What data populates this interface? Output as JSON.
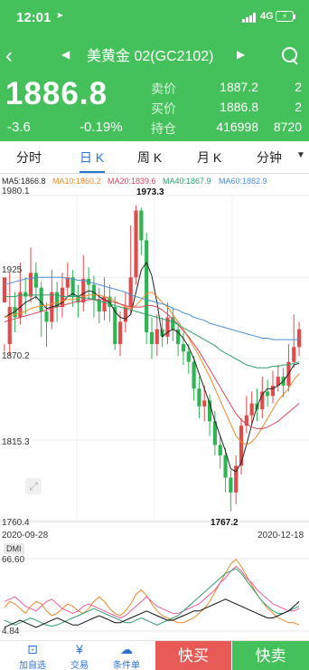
{
  "status": {
    "time": "12:01",
    "network": "4G",
    "battery_icon": "battery-charging-icon"
  },
  "nav": {
    "title": "美黄金 02(GC2102)"
  },
  "quote": {
    "price": "1886.8",
    "change": "-3.6",
    "change_pct": "-0.19%",
    "ask_label": "卖价",
    "ask": "1887.2",
    "ask_qty": "2",
    "bid_label": "买价",
    "bid": "1886.8",
    "bid_qty": "2",
    "oi_label": "持仓",
    "oi": "416998",
    "oi_qty": "8720"
  },
  "tabs": [
    "分时",
    "日 K",
    "周 K",
    "月 K",
    "分钟"
  ],
  "active_tab": "日 K",
  "ma_legend": [
    {
      "text": "MA5:1866.8",
      "color": "#222222"
    },
    {
      "text": "MA10:1860.2",
      "color": "#f08a2a"
    },
    {
      "text": "MA20:1839.6",
      "color": "#d6455b"
    },
    {
      "text": "MA40:1867.9",
      "color": "#2e9e6a"
    },
    {
      "text": "MA60:1882.9",
      "color": "#4a8ed8"
    }
  ],
  "chart_data": {
    "type": "candlestick",
    "y_labels": [
      "1980.1",
      "1925",
      "1870.2",
      "1815.3",
      "1760.4"
    ],
    "high_marker": "1973.3",
    "low_marker": "1767.2",
    "x_start": "2020-09-28",
    "x_end": "2020-12-18",
    "ylim": [
      1760.4,
      1980.1
    ],
    "candles": [
      [
        1908,
        1925,
        1880,
        1875
      ],
      [
        1880,
        1905,
        1928,
        1872
      ],
      [
        1905,
        1898,
        1915,
        1888
      ],
      [
        1898,
        1915,
        1935,
        1893
      ],
      [
        1915,
        1912,
        1925,
        1900
      ],
      [
        1912,
        1928,
        1945,
        1908
      ],
      [
        1928,
        1918,
        1935,
        1910
      ],
      [
        1918,
        1902,
        1922,
        1885
      ],
      [
        1902,
        1895,
        1908,
        1878
      ],
      [
        1895,
        1915,
        1930,
        1890
      ],
      [
        1915,
        1905,
        1922,
        1895
      ],
      [
        1905,
        1918,
        1928,
        1898
      ],
      [
        1918,
        1925,
        1935,
        1912
      ],
      [
        1925,
        1912,
        1930,
        1905
      ],
      [
        1912,
        1908,
        1920,
        1898
      ],
      [
        1908,
        1924,
        1940,
        1902
      ],
      [
        1924,
        1920,
        1932,
        1910
      ],
      [
        1920,
        1910,
        1926,
        1898
      ],
      [
        1910,
        1902,
        1918,
        1894
      ],
      [
        1902,
        1912,
        1925,
        1896
      ],
      [
        1912,
        1905,
        1920,
        1895
      ],
      [
        1905,
        1880,
        1912,
        1876
      ],
      [
        1880,
        1895,
        1902,
        1872
      ],
      [
        1895,
        1905,
        1915,
        1888
      ],
      [
        1905,
        1925,
        1960,
        1900
      ],
      [
        1925,
        1970,
        1973.3,
        1920
      ],
      [
        1970,
        1950,
        1972,
        1940
      ],
      [
        1950,
        1888,
        1955,
        1880
      ],
      [
        1888,
        1880,
        1898,
        1870
      ],
      [
        1880,
        1890,
        1900,
        1872
      ],
      [
        1890,
        1885,
        1898,
        1878
      ],
      [
        1885,
        1898,
        1908,
        1880
      ],
      [
        1898,
        1890,
        1905,
        1882
      ],
      [
        1890,
        1880,
        1895,
        1872
      ],
      [
        1880,
        1875,
        1888,
        1866
      ],
      [
        1875,
        1868,
        1880,
        1860
      ],
      [
        1868,
        1850,
        1872,
        1842
      ],
      [
        1850,
        1838,
        1858,
        1830
      ],
      [
        1838,
        1842,
        1852,
        1828
      ],
      [
        1842,
        1828,
        1846,
        1818
      ],
      [
        1828,
        1812,
        1835,
        1805
      ],
      [
        1812,
        1805,
        1818,
        1796
      ],
      [
        1805,
        1790,
        1810,
        1780
      ],
      [
        1790,
        1780,
        1795,
        1767.2
      ],
      [
        1780,
        1798,
        1805,
        1772
      ],
      [
        1798,
        1825,
        1830,
        1792
      ],
      [
        1825,
        1832,
        1845,
        1820
      ],
      [
        1832,
        1840,
        1848,
        1826
      ],
      [
        1840,
        1836,
        1850,
        1828
      ],
      [
        1836,
        1848,
        1858,
        1830
      ],
      [
        1848,
        1845,
        1856,
        1838
      ],
      [
        1845,
        1852,
        1862,
        1840
      ],
      [
        1852,
        1858,
        1866,
        1848
      ],
      [
        1858,
        1852,
        1864,
        1844
      ],
      [
        1852,
        1868,
        1880,
        1848
      ],
      [
        1868,
        1878,
        1900,
        1864
      ],
      [
        1878,
        1890,
        1895,
        1872
      ]
    ],
    "series": [
      {
        "name": "MA5",
        "color": "#222222",
        "values": [
          1898,
          1900,
          1902,
          1905,
          1908,
          1910,
          1912,
          1908,
          1904,
          1905,
          1906,
          1908,
          1912,
          1914,
          1912,
          1914,
          1916,
          1915,
          1912,
          1910,
          1908,
          1902,
          1898,
          1897,
          1900,
          1915,
          1930,
          1935,
          1926,
          1908,
          1885,
          1888,
          1890,
          1888,
          1884,
          1878,
          1870,
          1860,
          1850,
          1840,
          1828,
          1818,
          1808,
          1796,
          1794,
          1800,
          1812,
          1826,
          1838,
          1846,
          1850,
          1850,
          1852,
          1855,
          1860,
          1866,
          1867
        ]
      },
      {
        "name": "MA10",
        "color": "#f08a2a",
        "values": [
          1898,
          1899,
          1900,
          1901,
          1902,
          1904,
          1905,
          1906,
          1906,
          1907,
          1908,
          1909,
          1910,
          1910,
          1911,
          1912,
          1913,
          1913,
          1913,
          1912,
          1911,
          1909,
          1907,
          1905,
          1904,
          1906,
          1910,
          1914,
          1915,
          1912,
          1908,
          1905,
          1900,
          1895,
          1890,
          1884,
          1878,
          1872,
          1865,
          1858,
          1850,
          1842,
          1834,
          1826,
          1818,
          1814,
          1812,
          1814,
          1818,
          1824,
          1830,
          1836,
          1842,
          1846,
          1850,
          1856,
          1860
        ]
      },
      {
        "name": "MA20",
        "color": "#d6455b",
        "values": [
          1895,
          1896,
          1897,
          1898,
          1899,
          1900,
          1901,
          1902,
          1903,
          1904,
          1905,
          1906,
          1907,
          1908,
          1909,
          1909,
          1910,
          1910,
          1910,
          1910,
          1909,
          1908,
          1907,
          1906,
          1905,
          1905,
          1905,
          1906,
          1906,
          1905,
          1903,
          1900,
          1897,
          1893,
          1889,
          1885,
          1880,
          1875,
          1869,
          1863,
          1857,
          1851,
          1845,
          1839,
          1833,
          1829,
          1826,
          1824,
          1823,
          1823,
          1824,
          1826,
          1828,
          1831,
          1834,
          1837,
          1840
        ]
      },
      {
        "name": "MA40",
        "color": "#2e9e6a",
        "values": [
          1912,
          1912,
          1912,
          1913,
          1913,
          1913,
          1913,
          1913,
          1913,
          1913,
          1913,
          1912,
          1912,
          1912,
          1912,
          1911,
          1911,
          1910,
          1909,
          1908,
          1907,
          1906,
          1905,
          1904,
          1903,
          1902,
          1901,
          1900,
          1899,
          1898,
          1897,
          1896,
          1895,
          1893,
          1891,
          1889,
          1887,
          1885,
          1883,
          1881,
          1879,
          1876,
          1874,
          1872,
          1870,
          1868,
          1866,
          1865,
          1864,
          1864,
          1864,
          1865,
          1865,
          1866,
          1866,
          1867,
          1868
        ]
      },
      {
        "name": "MA60",
        "color": "#4a8ed8",
        "values": [
          1920,
          1921,
          1922,
          1923,
          1924,
          1924,
          1925,
          1925,
          1925,
          1925,
          1925,
          1925,
          1924,
          1924,
          1923,
          1923,
          1922,
          1921,
          1920,
          1919,
          1918,
          1917,
          1916,
          1915,
          1913,
          1912,
          1911,
          1910,
          1909,
          1908,
          1907,
          1906,
          1904,
          1903,
          1901,
          1900,
          1898,
          1897,
          1896,
          1894,
          1893,
          1892,
          1891,
          1890,
          1889,
          1888,
          1887,
          1886,
          1885,
          1884,
          1884,
          1883,
          1883,
          1883,
          1883,
          1883,
          1883
        ]
      }
    ]
  },
  "dmi": {
    "label": "DMI",
    "y_labels": [
      "66.60",
      "4.84"
    ],
    "ylim": [
      4.84,
      66.6
    ],
    "series": [
      {
        "color": "#e88a2a",
        "values": [
          25,
          30,
          28,
          24,
          20,
          26,
          30,
          28,
          22,
          18,
          20,
          24,
          28,
          26,
          22,
          20,
          24,
          30,
          34,
          30,
          24,
          20,
          18,
          22,
          28,
          36,
          40,
          35,
          28,
          22,
          18,
          16,
          14,
          12,
          12,
          14,
          16,
          20,
          24,
          30,
          38,
          46,
          54,
          62,
          66,
          60,
          52,
          44,
          36,
          30,
          24,
          20,
          16,
          14,
          12,
          12,
          10
        ]
      },
      {
        "color": "#e85a9a",
        "values": [
          30,
          32,
          34,
          30,
          26,
          24,
          22,
          26,
          30,
          32,
          28,
          24,
          22,
          20,
          22,
          26,
          28,
          26,
          24,
          22,
          20,
          18,
          16,
          18,
          22,
          26,
          30,
          34,
          30,
          26,
          24,
          22,
          20,
          20,
          22,
          24,
          26,
          28,
          32,
          36,
          40,
          46,
          50,
          56,
          60,
          56,
          50,
          46,
          40,
          36,
          32,
          28,
          26,
          24,
          22,
          22,
          24
        ]
      },
      {
        "color": "#2e9e6a",
        "values": [
          14,
          12,
          10,
          12,
          14,
          16,
          14,
          12,
          10,
          9,
          10,
          12,
          14,
          16,
          18,
          20,
          22,
          24,
          22,
          20,
          18,
          16,
          14,
          12,
          12,
          14,
          16,
          14,
          12,
          10,
          12,
          14,
          16,
          18,
          22,
          26,
          30,
          34,
          38,
          42,
          46,
          50,
          54,
          56,
          58,
          54,
          48,
          42,
          36,
          30,
          26,
          22,
          20,
          20,
          22,
          24,
          26
        ]
      },
      {
        "color": "#111111",
        "values": [
          8,
          10,
          12,
          14,
          12,
          10,
          8,
          10,
          12,
          14,
          16,
          14,
          12,
          10,
          10,
          12,
          14,
          16,
          18,
          16,
          14,
          12,
          12,
          14,
          16,
          18,
          20,
          22,
          20,
          18,
          16,
          14,
          14,
          16,
          18,
          20,
          22,
          22,
          24,
          26,
          28,
          30,
          32,
          30,
          28,
          26,
          24,
          22,
          20,
          18,
          16,
          16,
          18,
          20,
          22,
          26,
          30
        ]
      }
    ]
  },
  "bottom": {
    "items": [
      {
        "label": "加自选",
        "icon": "add-watchlist-icon"
      },
      {
        "label": "交易",
        "icon": "yen-icon"
      },
      {
        "label": "条件单",
        "icon": "cloud-icon"
      }
    ],
    "buy_label": "快买",
    "sell_label": "快卖"
  }
}
